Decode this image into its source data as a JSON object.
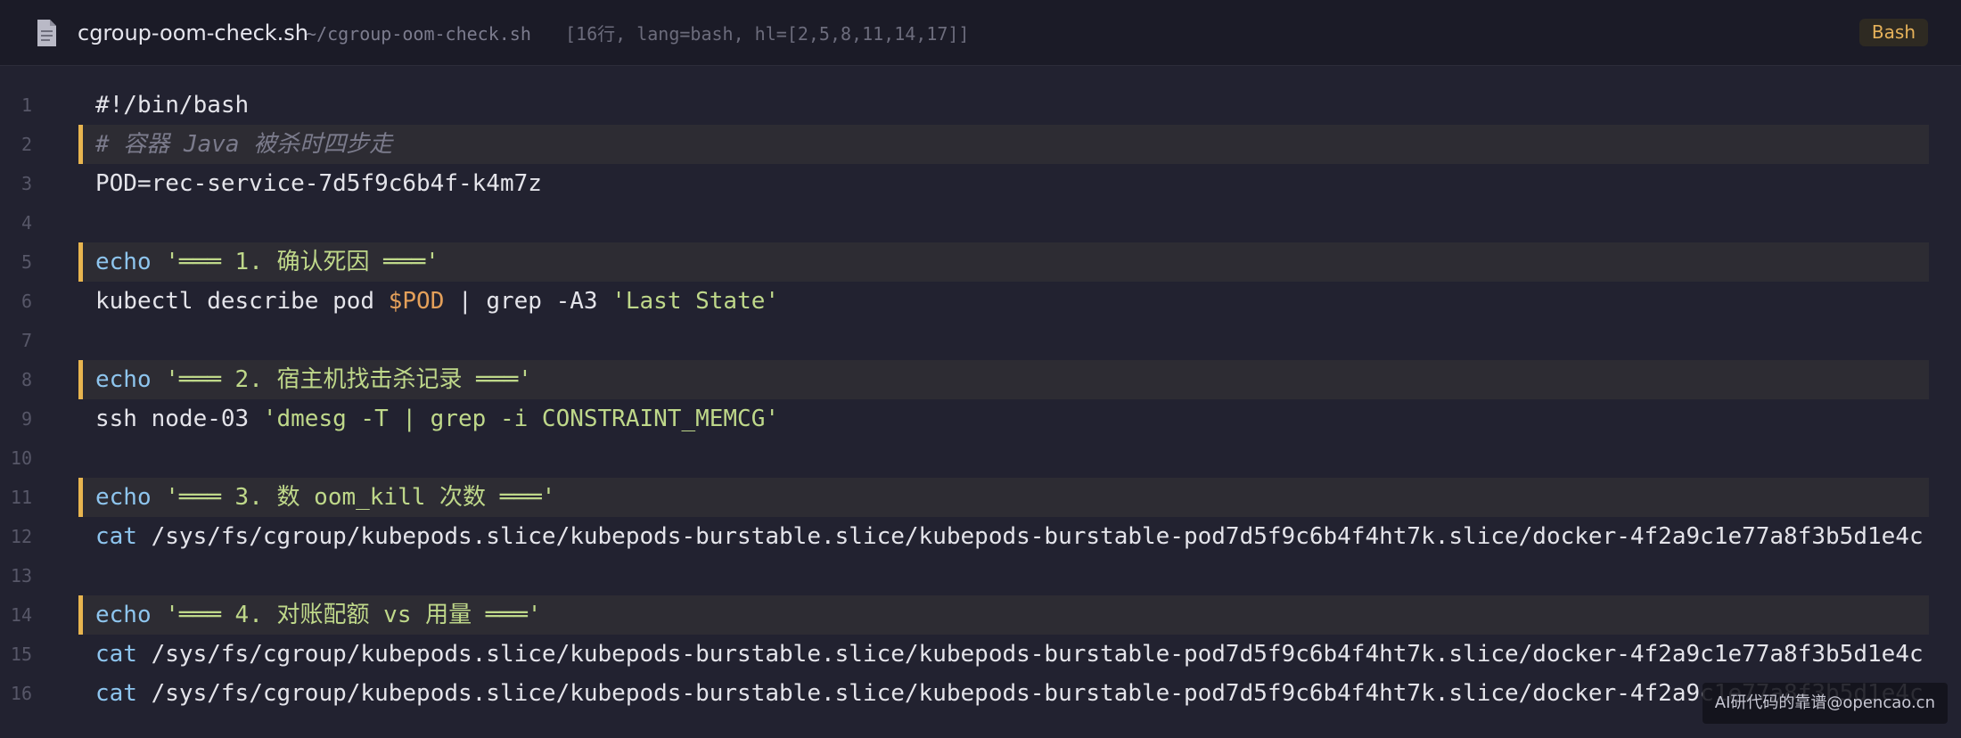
{
  "header": {
    "file_icon": "file-document-icon",
    "file_name": "cgroup-oom-check.sh",
    "file_path": "~/cgroup-oom-check.sh",
    "file_meta": "[16行, lang=bash, hl=[2,5,8,11,14,17]]",
    "language_badge": "Bash"
  },
  "colors": {
    "background": "#222230",
    "header_background": "#1b1b27",
    "highlight_background": "#2d2c33",
    "highlight_bar": "#e8b54f",
    "command": "#8ec5ee",
    "string": "#bfd88a",
    "variable": "#e4a05a",
    "comment": "#7b7b8c",
    "plain": "#e4e4ea",
    "line_number": "#575768"
  },
  "lines": [
    {
      "number": "1",
      "highlighted": false,
      "tokens": [
        {
          "type": "plain",
          "text": "#!/bin/bash"
        }
      ]
    },
    {
      "number": "2",
      "highlighted": true,
      "tokens": [
        {
          "type": "comment",
          "text": "# 容器 Java 被杀时四步走"
        }
      ]
    },
    {
      "number": "3",
      "highlighted": false,
      "tokens": [
        {
          "type": "plain",
          "text": "POD=rec-service-7d5f9c6b4f-k4m7z"
        }
      ]
    },
    {
      "number": "4",
      "highlighted": false,
      "tokens": []
    },
    {
      "number": "5",
      "highlighted": true,
      "tokens": [
        {
          "type": "cmd",
          "text": "echo"
        },
        {
          "type": "plain",
          "text": " "
        },
        {
          "type": "str",
          "text": "'═══ 1. 确认死因 ═══'"
        }
      ]
    },
    {
      "number": "6",
      "highlighted": false,
      "tokens": [
        {
          "type": "plain",
          "text": "kubectl describe pod "
        },
        {
          "type": "var",
          "text": "$POD"
        },
        {
          "type": "plain",
          "text": " | grep -A3 "
        },
        {
          "type": "str",
          "text": "'Last State'"
        }
      ]
    },
    {
      "number": "7",
      "highlighted": false,
      "tokens": []
    },
    {
      "number": "8",
      "highlighted": true,
      "tokens": [
        {
          "type": "cmd",
          "text": "echo"
        },
        {
          "type": "plain",
          "text": " "
        },
        {
          "type": "str",
          "text": "'═══ 2. 宿主机找击杀记录 ═══'"
        }
      ]
    },
    {
      "number": "9",
      "highlighted": false,
      "tokens": [
        {
          "type": "plain",
          "text": "ssh node-03 "
        },
        {
          "type": "str",
          "text": "'dmesg -T | grep -i CONSTRAINT_MEMCG'"
        }
      ]
    },
    {
      "number": "10",
      "highlighted": false,
      "tokens": []
    },
    {
      "number": "11",
      "highlighted": true,
      "tokens": [
        {
          "type": "cmd",
          "text": "echo"
        },
        {
          "type": "plain",
          "text": " "
        },
        {
          "type": "str",
          "text": "'═══ 3. 数 oom_kill 次数 ═══'"
        }
      ]
    },
    {
      "number": "12",
      "highlighted": false,
      "tokens": [
        {
          "type": "cmd",
          "text": "cat"
        },
        {
          "type": "plain",
          "text": " /sys/fs/cgroup/kubepods.slice/kubepods-burstable.slice/kubepods-burstable-pod7d5f9c6b4f4ht7k.slice/docker-4f2a9c1e77a8f3b5d1e4c"
        }
      ]
    },
    {
      "number": "13",
      "highlighted": false,
      "tokens": []
    },
    {
      "number": "14",
      "highlighted": true,
      "tokens": [
        {
          "type": "cmd",
          "text": "echo"
        },
        {
          "type": "plain",
          "text": " "
        },
        {
          "type": "str",
          "text": "'═══ 4. 对账配额 vs 用量 ═══'"
        }
      ]
    },
    {
      "number": "15",
      "highlighted": false,
      "tokens": [
        {
          "type": "cmd",
          "text": "cat"
        },
        {
          "type": "plain",
          "text": " /sys/fs/cgroup/kubepods.slice/kubepods-burstable.slice/kubepods-burstable-pod7d5f9c6b4f4ht7k.slice/docker-4f2a9c1e77a8f3b5d1e4c"
        }
      ]
    },
    {
      "number": "16",
      "highlighted": false,
      "tokens": [
        {
          "type": "cmd",
          "text": "cat"
        },
        {
          "type": "plain",
          "text": " /sys/fs/cgroup/kubepods.slice/kubepods-burstable.slice/kubepods-burstable-pod7d5f9c6b4f4ht7k.slice/docker-4f2a9c1e77a8f3b5d1e4c"
        }
      ]
    }
  ],
  "watermark": "AI研代码的靠谱@opencao.cn"
}
